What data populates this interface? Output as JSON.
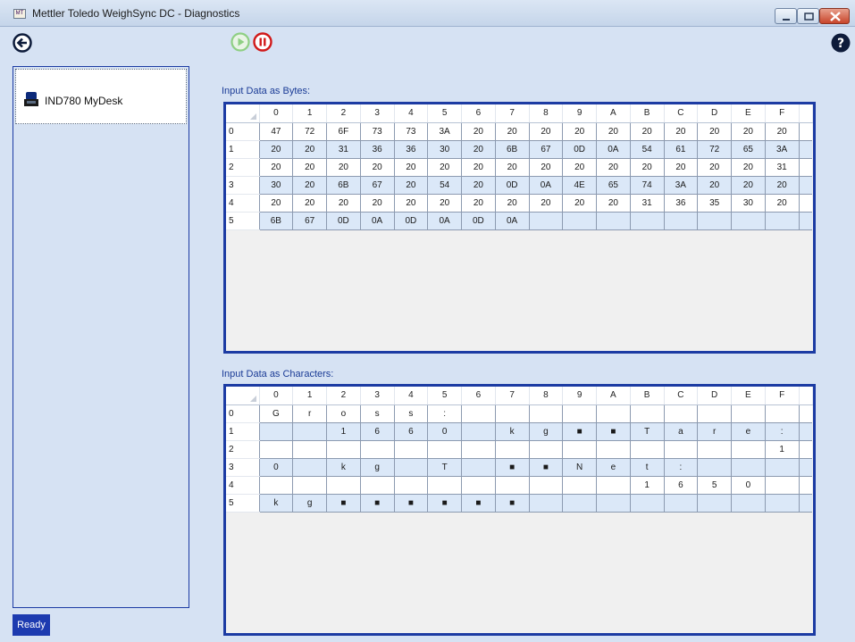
{
  "window": {
    "title": "Mettler Toledo WeighSync DC - Diagnostics",
    "app_icon_text": "MT"
  },
  "toolbar": {
    "back": "back-arrow",
    "play": "play",
    "stop": "stop",
    "help": "help"
  },
  "devices": [
    {
      "label": "IND780 MyDesk"
    }
  ],
  "status": {
    "text": "Ready"
  },
  "columns": [
    "0",
    "1",
    "2",
    "3",
    "4",
    "5",
    "6",
    "7",
    "8",
    "9",
    "A",
    "B",
    "C",
    "D",
    "E",
    "F"
  ],
  "row_headers": [
    "0",
    "1",
    "2",
    "3",
    "4",
    "5"
  ],
  "bytes": {
    "title": "Input Data as Bytes:",
    "rows": [
      [
        "47",
        "72",
        "6F",
        "73",
        "73",
        "3A",
        "20",
        "20",
        "20",
        "20",
        "20",
        "20",
        "20",
        "20",
        "20",
        "20"
      ],
      [
        "20",
        "20",
        "31",
        "36",
        "36",
        "30",
        "20",
        "6B",
        "67",
        "0D",
        "0A",
        "54",
        "61",
        "72",
        "65",
        "3A"
      ],
      [
        "20",
        "20",
        "20",
        "20",
        "20",
        "20",
        "20",
        "20",
        "20",
        "20",
        "20",
        "20",
        "20",
        "20",
        "20",
        "31"
      ],
      [
        "30",
        "20",
        "6B",
        "67",
        "20",
        "54",
        "20",
        "0D",
        "0A",
        "4E",
        "65",
        "74",
        "3A",
        "20",
        "20",
        "20"
      ],
      [
        "20",
        "20",
        "20",
        "20",
        "20",
        "20",
        "20",
        "20",
        "20",
        "20",
        "20",
        "31",
        "36",
        "35",
        "30",
        "20"
      ],
      [
        "6B",
        "67",
        "0D",
        "0A",
        "0D",
        "0A",
        "0D",
        "0A",
        "",
        "",
        "",
        "",
        "",
        "",
        "",
        ""
      ]
    ]
  },
  "chars": {
    "title": "Input Data as Characters:",
    "rows": [
      [
        "G",
        "r",
        "o",
        "s",
        "s",
        ":",
        "",
        "",
        "",
        "",
        "",
        "",
        "",
        "",
        "",
        ""
      ],
      [
        "",
        "",
        "1",
        "6",
        "6",
        "0",
        "",
        "k",
        "g",
        "■",
        "■",
        "T",
        "a",
        "r",
        "e",
        ":"
      ],
      [
        "",
        "",
        "",
        "",
        "",
        "",
        "",
        "",
        "",
        "",
        "",
        "",
        "",
        "",
        "",
        "1"
      ],
      [
        "0",
        "",
        "k",
        "g",
        "",
        "T",
        "",
        "■",
        "■",
        "N",
        "e",
        "t",
        ":",
        "",
        "",
        ""
      ],
      [
        "",
        "",
        "",
        "",
        "",
        "",
        "",
        "",
        "",
        "",
        "",
        "1",
        "6",
        "5",
        "0",
        ""
      ],
      [
        "k",
        "g",
        "■",
        "■",
        "■",
        "■",
        "■",
        "■",
        "",
        "",
        "",
        "",
        "",
        "",
        "",
        ""
      ]
    ]
  }
}
